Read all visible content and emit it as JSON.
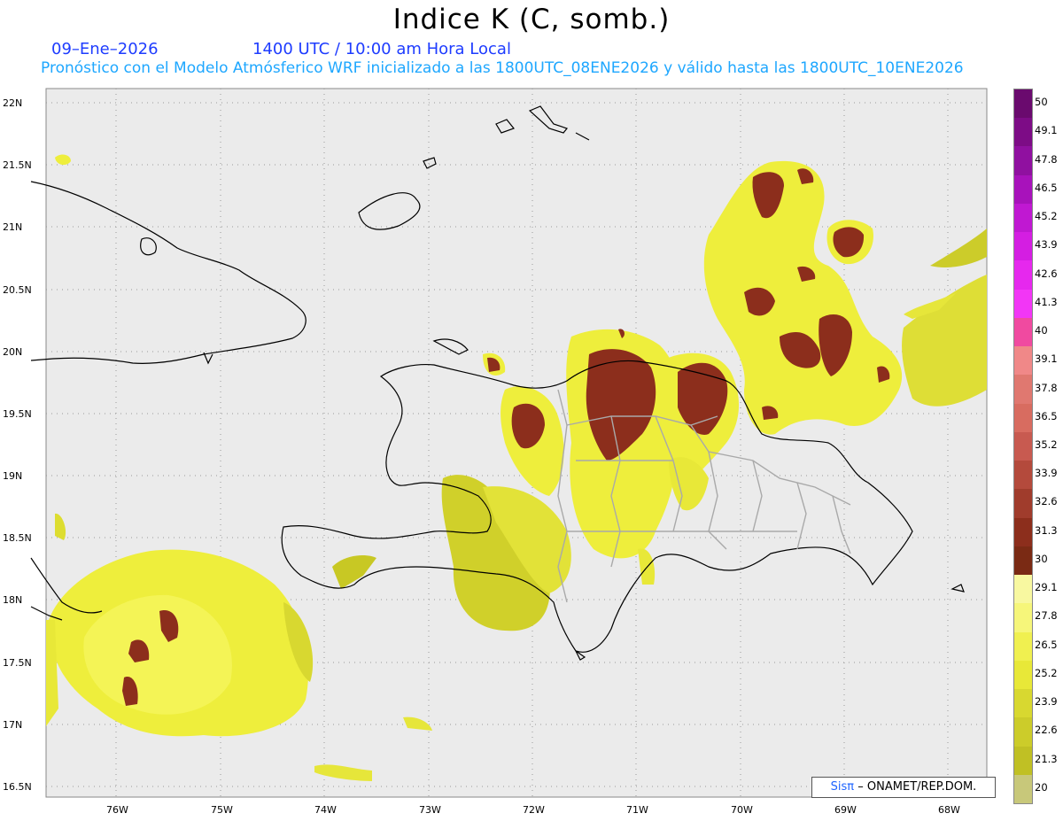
{
  "title": "Indice K (C, somb.)",
  "date": "09–Ene–2026",
  "time": "1400 UTC / 10:00 am Hora Local",
  "forecast": "Pronóstico con el Modelo Atmósferico WRF inicializado a las 1800UTC_08ENE2026 y válido hasta las  1800UTC_10ENE2026",
  "credit": {
    "logo": "Sisπ",
    "text": "– ONAMET/REP.DOM."
  },
  "lat_labels": [
    "22N",
    "21.5N",
    "21N",
    "20.5N",
    "20N",
    "19.5N",
    "19N",
    "18.5N",
    "18N",
    "17.5N",
    "17N",
    "16.5N"
  ],
  "lon_labels": [
    "76W",
    "75W",
    "74W",
    "73W",
    "72W",
    "71W",
    "70W",
    "69W",
    "68W"
  ],
  "colorbar": {
    "labels": [
      "50",
      "49.1",
      "47.8",
      "46.5",
      "45.2",
      "43.9",
      "42.6",
      "41.3",
      "40",
      "39.1",
      "37.8",
      "36.5",
      "35.2",
      "33.9",
      "32.6",
      "31.3",
      "30",
      "29.1",
      "27.8",
      "26.5",
      "25.2",
      "23.9",
      "22.6",
      "21.3",
      "20"
    ],
    "colors": [
      "#6a0a6e",
      "#7d0c86",
      "#9010a0",
      "#a812bb",
      "#c018d2",
      "#d41ee2",
      "#e628ee",
      "#f236f6",
      "#f04aa0",
      "#f08888",
      "#e07870",
      "#d86c60",
      "#c85a50",
      "#b44a3c",
      "#a03c2c",
      "#8c2e1c",
      "#7a2a14",
      "#f8f8a0",
      "#f6f67a",
      "#f0f050",
      "#e8e838",
      "#d8d830",
      "#cccc2a",
      "#c0c024",
      "#c8c87a"
    ]
  },
  "legend_range": {
    "min": 20,
    "max": 50,
    "units": "C"
  }
}
